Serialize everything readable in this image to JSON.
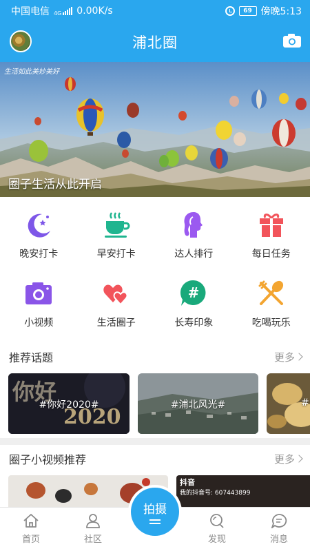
{
  "status_bar": {
    "carrier": "中国电信",
    "network": "4G",
    "speed": "0.00K/s",
    "battery": "69",
    "time": "傍晚5:13"
  },
  "header": {
    "title": "浦北圈",
    "left_icon": "avatar",
    "right_icon": "camera-icon"
  },
  "banner": {
    "slogan": "生活如此美妙美好",
    "caption": "圈子生活从此开启"
  },
  "features": [
    {
      "label": "晚安打卡",
      "icon": "moon-icon",
      "color": "#7e57e8"
    },
    {
      "label": "早安打卡",
      "icon": "coffee-cup-icon",
      "color": "#1fb58f"
    },
    {
      "label": "达人排行",
      "icon": "woman-profile-icon",
      "color": "#9b59f0"
    },
    {
      "label": "每日任务",
      "icon": "gift-icon",
      "color": "#f2545b"
    },
    {
      "label": "小视频",
      "icon": "camera-icon",
      "color": "#8a55e8"
    },
    {
      "label": "生活圈子",
      "icon": "hearts-icon",
      "color": "#f2545b"
    },
    {
      "label": "长寿印象",
      "icon": "hashtag-bubble-icon",
      "color": "#19a97b"
    },
    {
      "label": "吃喝玩乐",
      "icon": "fork-spoon-icon",
      "color": "#f3a531"
    }
  ],
  "topics_section": {
    "title": "推荐话题",
    "more": "更多",
    "items": [
      {
        "label": "#你好2020#",
        "art": "你好",
        "art2": "2020"
      },
      {
        "label": "#浦北风光#"
      },
      {
        "label": "#"
      }
    ]
  },
  "videos_section": {
    "title": "圈子小视频推荐",
    "more": "更多",
    "items": [
      {
        "label": ""
      },
      {
        "app": "抖音",
        "account": "我的抖音号: 607443899"
      }
    ]
  },
  "tabbar": {
    "items": [
      {
        "label": "首页",
        "icon": "home-icon"
      },
      {
        "label": "社区",
        "icon": "person-icon"
      },
      {
        "label": "发现",
        "icon": "discover-icon"
      },
      {
        "label": "消息",
        "icon": "message-icon"
      }
    ],
    "center": {
      "label": "拍摄"
    }
  },
  "colors": {
    "brand": "#2aa7ee"
  }
}
